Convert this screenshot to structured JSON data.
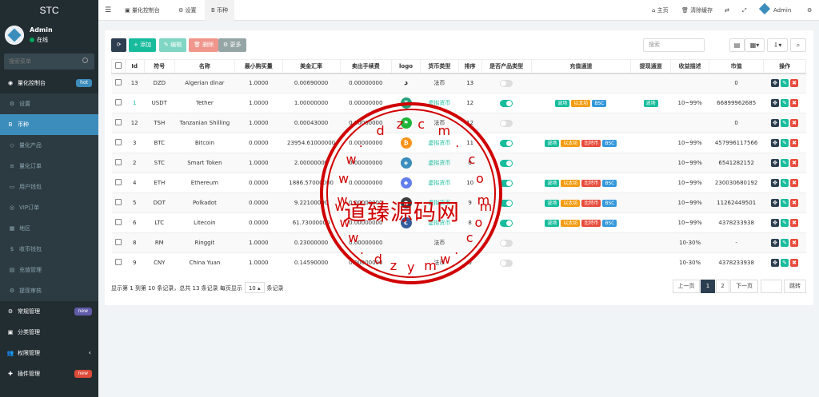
{
  "sidebar": {
    "logo": "STC",
    "user": "Admin",
    "status": "在线",
    "search_placeholder": "搜索菜单",
    "items": [
      {
        "label": "量化控制台",
        "badge": "hot",
        "type": "head",
        "icon": "dashboard-icon"
      },
      {
        "label": "设置",
        "type": "sub",
        "icon": "gear-icon"
      },
      {
        "label": "币种",
        "type": "active",
        "icon": "bitcoin-icon"
      },
      {
        "label": "量化产品",
        "type": "sub",
        "icon": "product-icon"
      },
      {
        "label": "量化订单",
        "type": "sub",
        "icon": "order-icon"
      },
      {
        "label": "用户钱包",
        "type": "sub",
        "icon": "wallet-icon"
      },
      {
        "label": "VIP订单",
        "type": "sub",
        "icon": "vip-icon"
      },
      {
        "label": "地区",
        "type": "sub",
        "icon": "map-icon"
      },
      {
        "label": "收币钱包",
        "type": "sub",
        "icon": "dollar-icon"
      },
      {
        "label": "充值管理",
        "type": "sub",
        "icon": "recharge-icon"
      },
      {
        "label": "提现审核",
        "type": "sub",
        "icon": "withdraw-icon"
      },
      {
        "label": "常规管理",
        "badge": "new",
        "type": "head",
        "icon": "cogs-icon"
      },
      {
        "label": "分类管理",
        "type": "head",
        "icon": "category-icon"
      },
      {
        "label": "权限管理",
        "type": "head",
        "icon": "users-icon",
        "chevron": true
      },
      {
        "label": "插件管理",
        "badge": "new",
        "type": "head",
        "icon": "plugin-icon"
      }
    ]
  },
  "topbar": {
    "tabs": [
      "量化控制台",
      "设置",
      "币种"
    ],
    "home": "主页",
    "clear_cache": "清除缓存",
    "admin": "Admin"
  },
  "toolbar": {
    "add": "添加",
    "edit": "编辑",
    "delete": "删除",
    "more": "更多",
    "search_placeholder": "搜索"
  },
  "colors": {
    "sidebar": "#222d32",
    "active": "#3c8dbc",
    "accent": "#18bc9c",
    "danger": "#e74c3c",
    "warning": "#f39c12",
    "info": "#3498db"
  },
  "table": {
    "headers": [
      "Id",
      "符号",
      "名称",
      "最小购买量",
      "美金汇率",
      "卖出手续费",
      "logo",
      "货币类型",
      "排序",
      "是否产品类型",
      "充值通道",
      "提现通道",
      "收益描述",
      "市值",
      "操作"
    ],
    "rows": [
      {
        "id": "13",
        "sym": "DZD",
        "name": "Algerian dinar",
        "min": "1.0000",
        "rate": "0.00690000",
        "fee": "0.00000000",
        "logo": "dzd",
        "type": "法币",
        "sort": "13",
        "on": false,
        "tags": [],
        "wtags": [],
        "profit": "",
        "cap": "0"
      },
      {
        "id": "1",
        "sym": "USDT",
        "name": "Tether",
        "min": "1.0000",
        "rate": "1.00000000",
        "fee": "0.00000000",
        "logo": "usdt",
        "type": "虚拟货币",
        "sort": "12",
        "on": true,
        "tags": [
          "波场",
          "以太坊",
          "BSC"
        ],
        "wtags": [
          "波场"
        ],
        "profit": "10~99%",
        "cap": "66899962685"
      },
      {
        "id": "12",
        "sym": "TSH",
        "name": "Tanzanian Shilling",
        "min": "1.0000",
        "rate": "0.00043000",
        "fee": "0.00000000",
        "logo": "tsh",
        "type": "法币",
        "sort": "12",
        "on": false,
        "tags": [],
        "wtags": [],
        "profit": "",
        "cap": "0"
      },
      {
        "id": "3",
        "sym": "BTC",
        "name": "Bitcoin",
        "min": "0.0000",
        "rate": "23954.61000000",
        "fee": "0.00000000",
        "logo": "btc",
        "type": "虚拟货币",
        "sort": "11",
        "on": true,
        "tags": [
          "波场",
          "以太坊",
          "比特币",
          "BSC"
        ],
        "wtags": [],
        "profit": "10~99%",
        "cap": "457996117566"
      },
      {
        "id": "2",
        "sym": "STC",
        "name": "Smart Token",
        "min": "1.0000",
        "rate": "2.00000000",
        "fee": "0.00000000",
        "logo": "stc",
        "type": "虚拟货币",
        "sort": "0",
        "on": true,
        "tags": [],
        "wtags": [],
        "profit": "10~99%",
        "cap": "6541282152"
      },
      {
        "id": "4",
        "sym": "ETH",
        "name": "Ethereum",
        "min": "0.0000",
        "rate": "1886.57000000",
        "fee": "0.00000000",
        "logo": "eth",
        "type": "虚拟货币",
        "sort": "10",
        "on": true,
        "tags": [
          "波场",
          "以太坊",
          "比特币",
          "BSC"
        ],
        "wtags": [],
        "profit": "10~99%",
        "cap": "230030680192"
      },
      {
        "id": "5",
        "sym": "DOT",
        "name": "Polkadot",
        "min": "0.0000",
        "rate": "9.22100000",
        "fee": "0.00000000",
        "logo": "dot",
        "type": "虚拟货币",
        "sort": "9",
        "on": true,
        "tags": [
          "波场",
          "以太坊",
          "比特币",
          "BSC"
        ],
        "wtags": [],
        "profit": "10~99%",
        "cap": "11262449501"
      },
      {
        "id": "6",
        "sym": "LTC",
        "name": "Litecoin",
        "min": "0.0000",
        "rate": "61.73000000",
        "fee": "0.00000000",
        "logo": "ltc",
        "type": "虚拟货币",
        "sort": "8",
        "on": true,
        "tags": [
          "波场",
          "以太坊",
          "比特币",
          "BSC"
        ],
        "wtags": [],
        "profit": "10~99%",
        "cap": "4378233938"
      },
      {
        "id": "8",
        "sym": "RM",
        "name": "Ringgit",
        "min": "1.0000",
        "rate": "0.23000000",
        "fee": "0.00000000",
        "logo": "",
        "type": "法币",
        "sort": "",
        "on": false,
        "tags": [],
        "wtags": [],
        "profit": "10-30%",
        "cap": "-"
      },
      {
        "id": "9",
        "sym": "CNY",
        "name": "China Yuan",
        "min": "1.0000",
        "rate": "0.14590000",
        "fee": "0.00000000",
        "logo": "",
        "type": "法币",
        "sort": "0",
        "on": false,
        "tags": [],
        "wtags": [],
        "profit": "10-30%",
        "cap": "4378233938"
      }
    ]
  },
  "pagination": {
    "info_pre": "显示第 1 到第 10 条记录，总共 13 条记录 每页显示",
    "per_page": "10",
    "info_post": "条记录",
    "prev": "上一页",
    "p1": "1",
    "p2": "2",
    "next": "下一页",
    "jump": "跳转"
  },
  "watermark": {
    "text": "道臻源码网",
    "url_top": "www.dzcm.com",
    "url_bottom": "www.dzymw.com"
  }
}
